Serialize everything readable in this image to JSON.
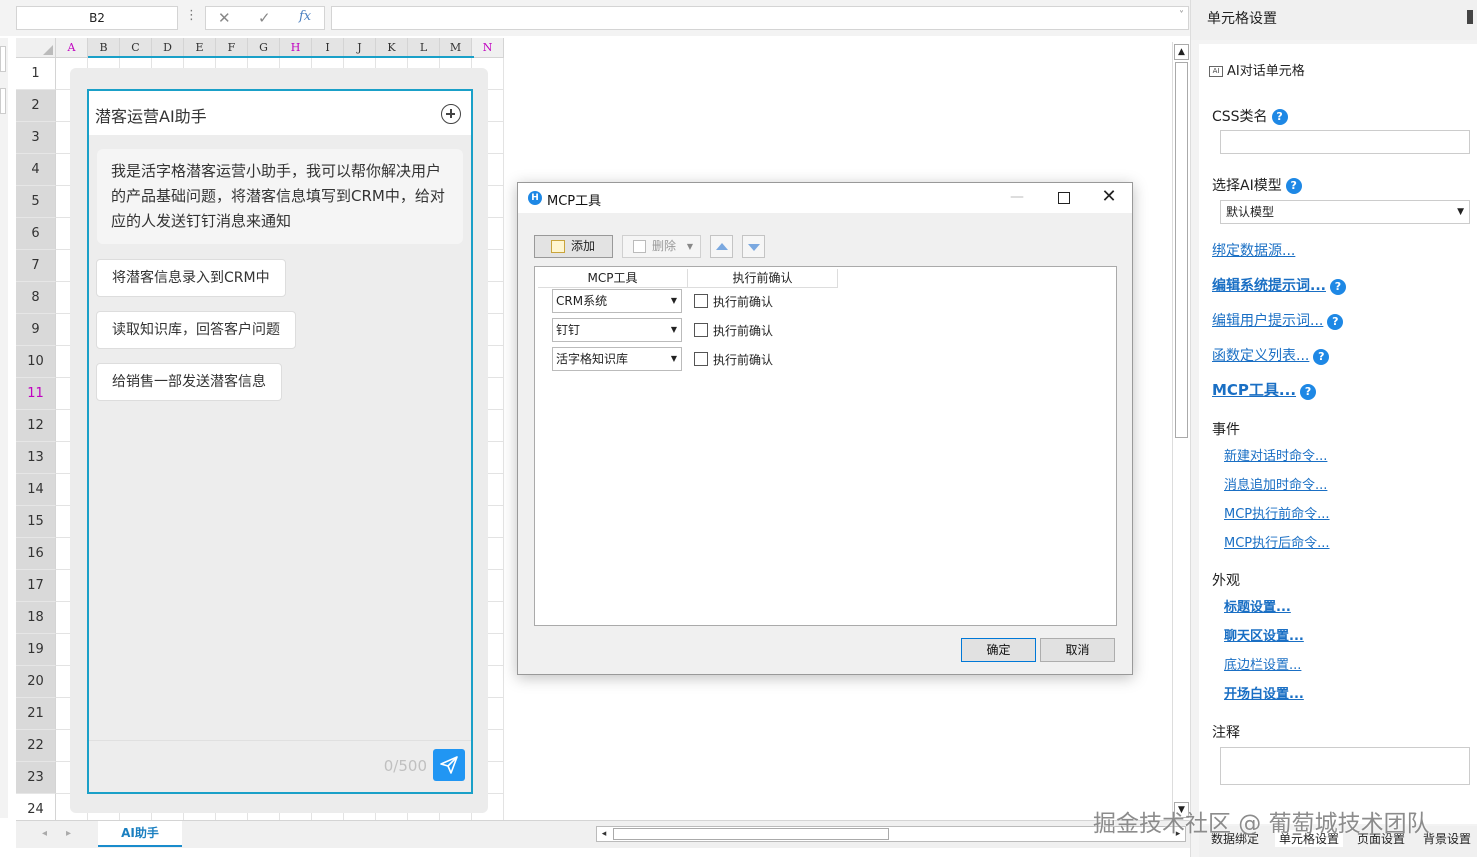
{
  "formula_bar": {
    "cell_ref": "B2",
    "dots": "⋮",
    "cancel_icon": "✕",
    "confirm_icon": "✓",
    "fx_label": "fx",
    "value": "",
    "expand_icon": "˅"
  },
  "grid": {
    "columns": [
      {
        "label": "A",
        "accent": true,
        "sel": false
      },
      {
        "label": "B",
        "accent": false,
        "sel": true
      },
      {
        "label": "C",
        "accent": false,
        "sel": true
      },
      {
        "label": "D",
        "accent": false,
        "sel": true
      },
      {
        "label": "E",
        "accent": false,
        "sel": true
      },
      {
        "label": "F",
        "accent": false,
        "sel": true
      },
      {
        "label": "G",
        "accent": false,
        "sel": true
      },
      {
        "label": "H",
        "accent": true,
        "sel": true
      },
      {
        "label": "I",
        "accent": false,
        "sel": true
      },
      {
        "label": "J",
        "accent": false,
        "sel": true
      },
      {
        "label": "K",
        "accent": false,
        "sel": true
      },
      {
        "label": "L",
        "accent": false,
        "sel": true
      },
      {
        "label": "M",
        "accent": false,
        "sel": true
      },
      {
        "label": "N",
        "accent": true,
        "sel": false
      }
    ],
    "rows": [
      "1",
      "2",
      "3",
      "4",
      "5",
      "6",
      "7",
      "8",
      "9",
      "10",
      "11",
      "12",
      "13",
      "14",
      "15",
      "16",
      "17",
      "18",
      "19",
      "20",
      "21",
      "22",
      "23",
      "24"
    ],
    "accent_row": "11"
  },
  "chat": {
    "title": "潜客运营AI助手",
    "greeting": "我是活字格潜客运营小助手，我可以帮你解决用户的产品基础问题，将潜客信息填写到CRM中，给对应的人发送钉钉消息来通知",
    "suggestions": [
      "将潜客信息录入到CRM中",
      "读取知识库，回答客户问题",
      "给销售一部发送潜客信息"
    ],
    "counter": "0/500",
    "send_icon": "send-icon"
  },
  "sheet_tabs": {
    "active": "AI助手",
    "prev": "◂",
    "next": "▸",
    "scroll_left": "◂",
    "scroll_right": "▸"
  },
  "vscroll": {
    "up": "▲",
    "down": "▼"
  },
  "dialog": {
    "title": "MCP工具",
    "icon_letter": "H",
    "minimize": "—",
    "close": "✕",
    "toolbar": {
      "add": "添加",
      "delete": "删除"
    },
    "columns": [
      "MCP工具",
      "执行前确认"
    ],
    "rows": [
      {
        "tool": "CRM系统",
        "confirm_label": "执行前确认",
        "checked": false
      },
      {
        "tool": "钉钉",
        "confirm_label": "执行前确认",
        "checked": false
      },
      {
        "tool": "活字格知识库",
        "confirm_label": "执行前确认",
        "checked": false
      }
    ],
    "ok": "确定",
    "cancel": "取消"
  },
  "panel": {
    "title": "单元格设置",
    "cell_type": "AI对话单元格",
    "cell_type_icon": "AI",
    "css_label": "CSS类名",
    "css_value": "",
    "model_label": "选择AI模型",
    "model_value": "默认模型",
    "bind_source": "绑定数据源...",
    "edit_system_prompt": "编辑系统提示词...",
    "edit_user_prompt": "编辑用户提示词...",
    "functions": "函数定义列表...",
    "mcp_tools": "MCP工具...",
    "events_label": "事件",
    "events": [
      "新建对话时命令...",
      "消息追加时命令...",
      "MCP执行前命令...",
      "MCP执行后命令..."
    ],
    "appearance_label": "外观",
    "appearance": [
      "标题设置...",
      "聊天区设置...",
      "底边栏设置...",
      "开场白设置..."
    ],
    "note_label": "注释",
    "note_value": "",
    "help": "?",
    "tabs": [
      "数据绑定",
      "单元格设置",
      "页面设置",
      "背景设置"
    ]
  },
  "watermark": "掘金技术社区 @ 葡萄城技术团队"
}
